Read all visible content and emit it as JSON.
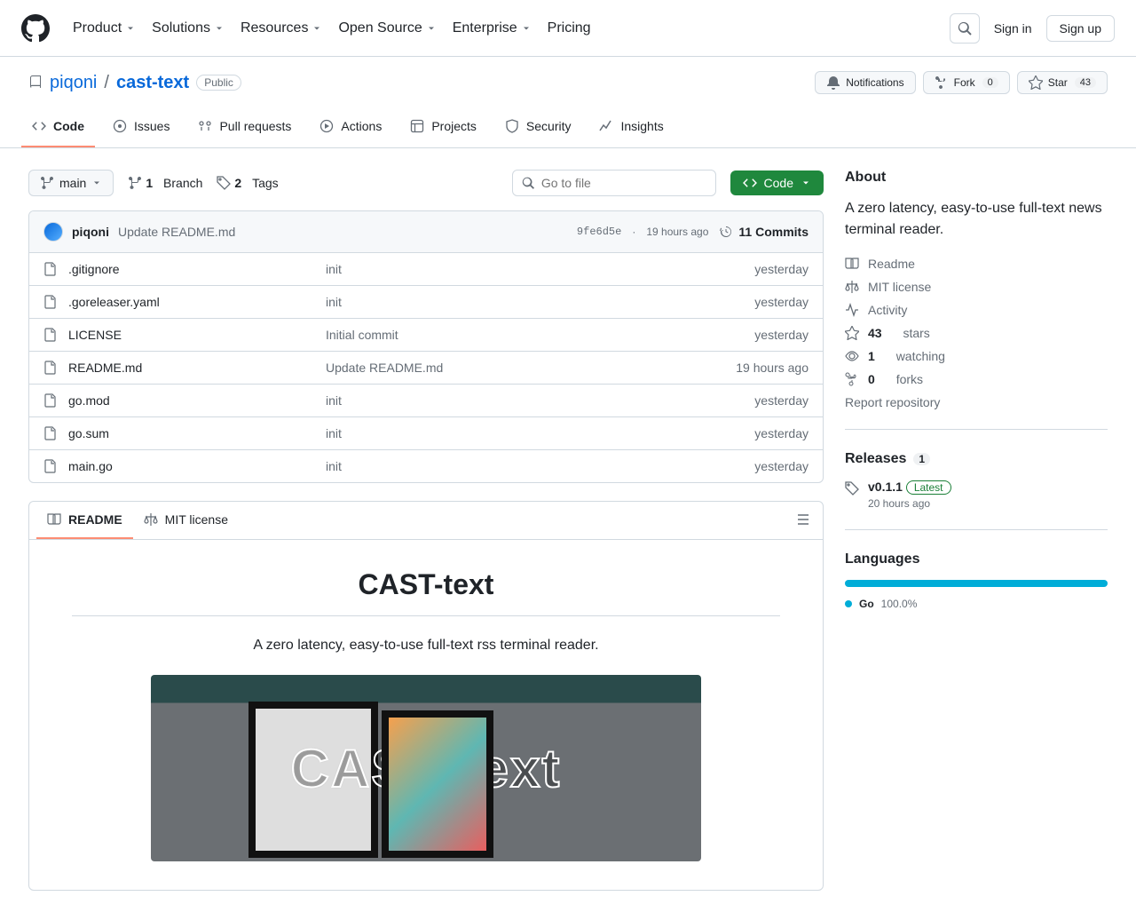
{
  "header": {
    "nav": [
      "Product",
      "Solutions",
      "Resources",
      "Open Source",
      "Enterprise",
      "Pricing"
    ],
    "signin": "Sign in",
    "signup": "Sign up"
  },
  "repo": {
    "owner": "piqoni",
    "name": "cast-text",
    "visibility": "Public",
    "notifications": "Notifications",
    "fork": "Fork",
    "fork_count": "0",
    "star": "Star",
    "star_count": "43"
  },
  "tabs": {
    "code": "Code",
    "issues": "Issues",
    "pulls": "Pull requests",
    "actions": "Actions",
    "projects": "Projects",
    "security": "Security",
    "insights": "Insights"
  },
  "toolbar": {
    "branch": "main",
    "branches_count": "1",
    "branches_label": "Branch",
    "tags_count": "2",
    "tags_label": "Tags",
    "search_placeholder": "Go to file",
    "code_btn": "Code"
  },
  "commit": {
    "author": "piqoni",
    "message": "Update README.md",
    "sha": "9fe6d5e",
    "sep": "·",
    "time": "19 hours ago",
    "commits_label": "11 Commits"
  },
  "files": [
    {
      "name": ".gitignore",
      "msg": "init",
      "date": "yesterday"
    },
    {
      "name": ".goreleaser.yaml",
      "msg": "init",
      "date": "yesterday"
    },
    {
      "name": "LICENSE",
      "msg": "Initial commit",
      "date": "yesterday"
    },
    {
      "name": "README.md",
      "msg": "Update README.md",
      "date": "19 hours ago"
    },
    {
      "name": "go.mod",
      "msg": "init",
      "date": "yesterday"
    },
    {
      "name": "go.sum",
      "msg": "init",
      "date": "yesterday"
    },
    {
      "name": "main.go",
      "msg": "init",
      "date": "yesterday"
    }
  ],
  "readme_tabs": {
    "readme": "README",
    "license": "MIT license"
  },
  "readme": {
    "title": "CAST-text",
    "tagline": "A zero latency, easy-to-use full-text rss terminal reader."
  },
  "about": {
    "heading": "About",
    "desc": "A zero latency, easy-to-use full-text news terminal reader.",
    "readme": "Readme",
    "license": "MIT license",
    "activity": "Activity",
    "stars_count": "43",
    "stars_label": "stars",
    "watching_count": "1",
    "watching_label": "watching",
    "forks_count": "0",
    "forks_label": "forks",
    "report": "Report repository"
  },
  "releases": {
    "heading": "Releases",
    "count": "1",
    "version": "v0.1.1",
    "latest": "Latest",
    "date": "20 hours ago"
  },
  "languages": {
    "heading": "Languages",
    "lang": "Go",
    "pct": "100.0%"
  }
}
